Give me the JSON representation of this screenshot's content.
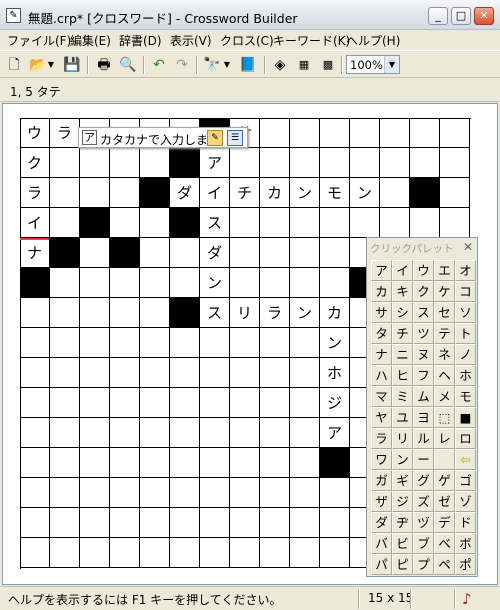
{
  "window": {
    "title": "無題.crp* [クロスワード] - Crossword Builder",
    "icon_name": "app-icon",
    "minimize": "_",
    "maximize": "□",
    "close": "✕"
  },
  "menu": [
    "ファイル(F)",
    "編集(E)",
    "辞書(D)",
    "表示(V)",
    "クロス(C)",
    "キーワード(K)",
    "ヘルプ(H)"
  ],
  "toolbar": {
    "icons": [
      "new-icon",
      "open-icon",
      "save-icon",
      "print-icon",
      "print-preview-icon",
      "undo-icon",
      "redo-icon",
      "find-icon",
      "dictionary-icon",
      "clear-icon",
      "check-icon",
      "number-icon"
    ],
    "zoom": "100%"
  },
  "position": "1, 5  タテ",
  "grid": {
    "size": 15,
    "rows": [
      [
        "ウ",
        "ラ",
        "",
        "",
        "",
        "",
        "#",
        "サ",
        "",
        "",
        "",
        "",
        "",
        "",
        ""
      ],
      [
        "ク",
        "",
        "",
        "",
        "",
        "#",
        "ア",
        "",
        "",
        "",
        "",
        "",
        "",
        "",
        ""
      ],
      [
        "ラ",
        "",
        "",
        "",
        "#",
        "ダ",
        "イ",
        "チ",
        "カ",
        "ン",
        "モ",
        "ン",
        "",
        "#",
        ""
      ],
      [
        "イ",
        "",
        "#",
        "",
        "",
        "#",
        "ス",
        "",
        "",
        "",
        "",
        "",
        "",
        "",
        ""
      ],
      [
        "ナ",
        "#",
        "",
        "#",
        "",
        "",
        "ダ",
        "",
        "",
        "",
        "",
        "",
        "",
        "",
        ""
      ],
      [
        "#",
        "",
        "",
        "",
        "",
        "",
        "ン",
        "",
        "",
        "",
        "",
        "#",
        "",
        "",
        ""
      ],
      [
        "",
        "",
        "",
        "",
        "",
        "#",
        "ス",
        "リ",
        "ラ",
        "ン",
        "カ",
        "",
        "",
        "",
        ""
      ],
      [
        "",
        "",
        "",
        "",
        "",
        "",
        "",
        "",
        "",
        "",
        "ン",
        "",
        "",
        "",
        ""
      ],
      [
        "",
        "",
        "",
        "",
        "",
        "",
        "",
        "",
        "",
        "",
        "ホ",
        "",
        "",
        "",
        ""
      ],
      [
        "",
        "",
        "",
        "",
        "",
        "",
        "",
        "",
        "",
        "",
        "ジ",
        "",
        "",
        "",
        ""
      ],
      [
        "",
        "",
        "",
        "",
        "",
        "",
        "",
        "",
        "",
        "",
        "ア",
        "",
        "",
        "",
        ""
      ],
      [
        "",
        "",
        "",
        "",
        "",
        "",
        "",
        "",
        "",
        "",
        "#",
        "",
        "",
        "",
        ""
      ],
      [
        "",
        "",
        "",
        "",
        "",
        "",
        "",
        "",
        "",
        "",
        "",
        "",
        "",
        "",
        ""
      ],
      [
        "",
        "",
        "",
        "",
        "",
        "",
        "",
        "",
        "",
        "",
        "",
        "",
        "",
        "",
        ""
      ],
      [
        "",
        "",
        "",
        "",
        "",
        "",
        "",
        "",
        "",
        "",
        "",
        "",
        "",
        "",
        ""
      ]
    ]
  },
  "ime": {
    "mode": "ア",
    "text": "カタカナで入力します"
  },
  "palette": {
    "title": "クリックパレット",
    "close": "✕",
    "keys": [
      [
        "ア",
        "イ",
        "ウ",
        "エ",
        "オ"
      ],
      [
        "カ",
        "キ",
        "ク",
        "ケ",
        "コ"
      ],
      [
        "サ",
        "シ",
        "ス",
        "セ",
        "ソ"
      ],
      [
        "タ",
        "チ",
        "ツ",
        "テ",
        "ト"
      ],
      [
        "ナ",
        "ニ",
        "ヌ",
        "ネ",
        "ノ"
      ],
      [
        "ハ",
        "ヒ",
        "フ",
        "ヘ",
        "ホ"
      ],
      [
        "マ",
        "ミ",
        "ム",
        "メ",
        "モ"
      ],
      [
        "ヤ",
        "ユ",
        "ヨ",
        "⬚",
        "■"
      ],
      [
        "ラ",
        "リ",
        "ル",
        "レ",
        "ロ"
      ],
      [
        "ワ",
        "ン",
        "ー",
        "",
        "⇦"
      ],
      [
        "ガ",
        "ギ",
        "グ",
        "ゲ",
        "ゴ"
      ],
      [
        "ザ",
        "ジ",
        "ズ",
        "ゼ",
        "ゾ"
      ],
      [
        "ダ",
        "ヂ",
        "ヅ",
        "デ",
        "ド"
      ],
      [
        "バ",
        "ビ",
        "ブ",
        "ベ",
        "ボ"
      ],
      [
        "パ",
        "ピ",
        "プ",
        "ペ",
        "ポ"
      ]
    ]
  },
  "status": {
    "help": "ヘルプを表示するには F1 キーを押してください。",
    "size": "15 x 15"
  }
}
